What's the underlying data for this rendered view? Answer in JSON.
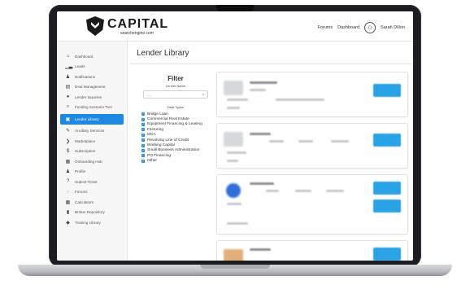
{
  "header": {
    "brand": "CAPITAL",
    "brand_sub": "searchengine.com",
    "nav": [
      "Forums",
      "Dashboard"
    ],
    "user": "Sarah Dillon"
  },
  "sidebar": {
    "items": [
      {
        "label": "Dashboard",
        "icon": "home-icon"
      },
      {
        "label": "Leads",
        "icon": "chart-icon"
      },
      {
        "label": "Notifications",
        "icon": "bell-icon"
      },
      {
        "label": "Deal Management",
        "icon": "clipboard-icon"
      },
      {
        "label": "Lender Inquiries",
        "icon": "chat-icon"
      },
      {
        "label": "Funding Scenario Tool",
        "icon": "search-icon"
      },
      {
        "label": "Lender Library",
        "icon": "book-icon",
        "active": true
      },
      {
        "label": "Ancillary Services",
        "icon": "wrench-icon"
      },
      {
        "label": "Marketplace",
        "icon": "chevron-icon"
      },
      {
        "label": "Subscription",
        "icon": "dollar-icon"
      },
      {
        "label": "Onboarding Hub",
        "icon": "calendar-icon"
      },
      {
        "label": "Profile",
        "icon": "user-icon"
      },
      {
        "label": "Submit Ticket",
        "icon": "question-icon"
      },
      {
        "label": "Forums",
        "icon": "forum-icon"
      },
      {
        "label": "Calculators",
        "icon": "calculator-icon"
      },
      {
        "label": "Broker Repository",
        "icon": "bookmark-icon"
      },
      {
        "label": "Training Library",
        "icon": "graduation-icon"
      }
    ]
  },
  "page": {
    "title": "Lender Library"
  },
  "filter": {
    "heading": "Filter",
    "lender_name_label": "Lender Name",
    "lender_name_value": "----",
    "deal_types_label": "Deal Types",
    "deal_types": [
      "Bridge Loan",
      "Commercial Real Estate",
      "Equipment Financing & Leasing",
      "Factoring",
      "MCA",
      "Revolving Line of Credit",
      "Working Capital",
      "Small Business Administration",
      "PO Financing",
      "Other"
    ]
  }
}
